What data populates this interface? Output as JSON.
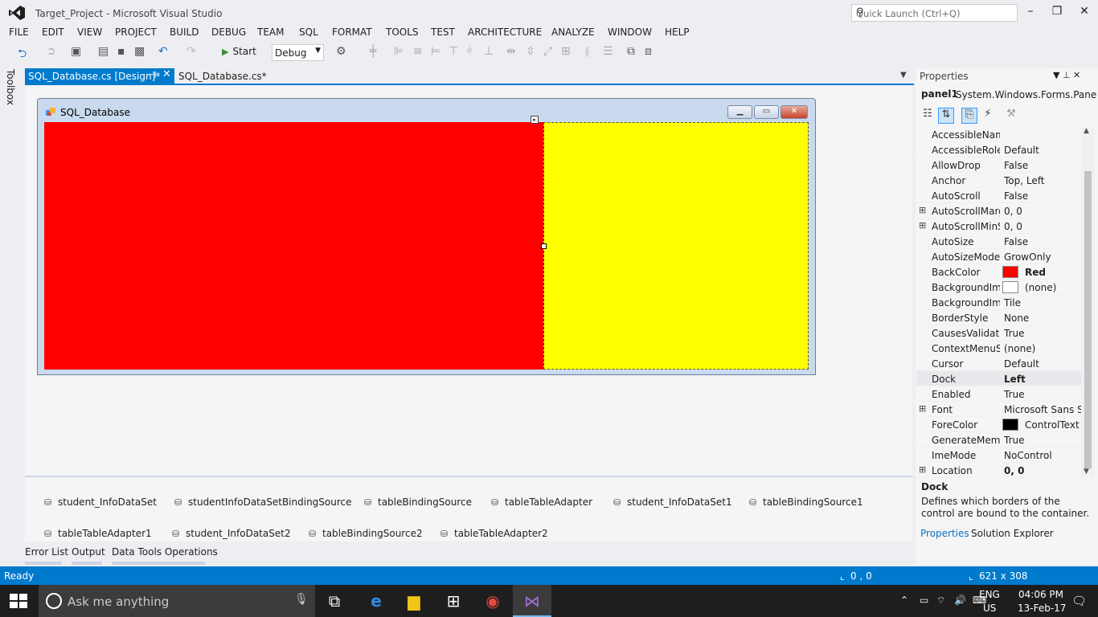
{
  "window": {
    "title": "Target_Project - Microsoft Visual Studio",
    "quick_launch_placeholder": "Quick Launch (Ctrl+Q)"
  },
  "menu": [
    "FILE",
    "EDIT",
    "VIEW",
    "PROJECT",
    "BUILD",
    "DEBUG",
    "TEAM",
    "SQL",
    "FORMAT",
    "TOOLS",
    "TEST",
    "ARCHITECTURE",
    "ANALYZE",
    "WINDOW",
    "HELP"
  ],
  "toolbar": {
    "start_label": "Start",
    "config": "Debug"
  },
  "toolbox_label": "Toolbox",
  "tabs": {
    "active": "SQL_Database.cs [Design]*",
    "inactive": "SQL_Database.cs*"
  },
  "form": {
    "title": "SQL_Database"
  },
  "panels": {
    "left_color": "#ff0000",
    "right_color": "#ffff00"
  },
  "component_tray": [
    "student_InfoDataSet",
    "studentInfoDataSetBindingSource",
    "tableBindingSource",
    "tableTableAdapter",
    "student_InfoDataSet1",
    "tableBindingSource1",
    "tableTableAdapter1",
    "student_InfoDataSet2",
    "tableBindingSource2",
    "tableTableAdapter2"
  ],
  "bottom_tabs": [
    "Error List",
    "Output",
    "Data Tools Operations"
  ],
  "properties": {
    "header": "Properties",
    "object_name": "panel1",
    "object_type": "System.Windows.Forms.Pane",
    "rows": [
      {
        "name": "AccessibleName",
        "value": ""
      },
      {
        "name": "AccessibleRole",
        "value": "Default"
      },
      {
        "name": "AllowDrop",
        "value": "False"
      },
      {
        "name": "Anchor",
        "value": "Top, Left"
      },
      {
        "name": "AutoScroll",
        "value": "False"
      },
      {
        "name": "AutoScrollMargin",
        "value": "0, 0",
        "expand": true
      },
      {
        "name": "AutoScrollMinSize",
        "value": "0, 0",
        "expand": true
      },
      {
        "name": "AutoSize",
        "value": "False"
      },
      {
        "name": "AutoSizeMode",
        "value": "GrowOnly"
      },
      {
        "name": "BackColor",
        "value": "Red",
        "swatch": "#ff0000",
        "bold": true
      },
      {
        "name": "BackgroundImage",
        "value": "(none)",
        "swatch": "#ffffff"
      },
      {
        "name": "BackgroundImageLayout",
        "value": "Tile"
      },
      {
        "name": "BorderStyle",
        "value": "None"
      },
      {
        "name": "CausesValidation",
        "value": "True"
      },
      {
        "name": "ContextMenuStrip",
        "value": "(none)"
      },
      {
        "name": "Cursor",
        "value": "Default"
      },
      {
        "name": "Dock",
        "value": "Left",
        "bold": true
      },
      {
        "name": "Enabled",
        "value": "True"
      },
      {
        "name": "Font",
        "value": "Microsoft Sans Se",
        "expand": true
      },
      {
        "name": "ForeColor",
        "value": "ControlText",
        "swatch": "#000000"
      },
      {
        "name": "GenerateMember",
        "value": "True"
      },
      {
        "name": "ImeMode",
        "value": "NoControl"
      },
      {
        "name": "Location",
        "value": "0, 0",
        "expand": true,
        "bold": true
      }
    ],
    "desc_name": "Dock",
    "desc_text": "Defines which borders of the control are bound to the container.",
    "tab_properties": "Properties",
    "tab_solution": "Solution Explorer"
  },
  "status": {
    "left": "Ready",
    "position": "0 , 0",
    "size": "621 x 308"
  },
  "taskbar": {
    "search_placeholder": "Ask me anything",
    "lang": "ENG",
    "region": "US",
    "time": "04:06 PM",
    "date": "13-Feb-17"
  }
}
